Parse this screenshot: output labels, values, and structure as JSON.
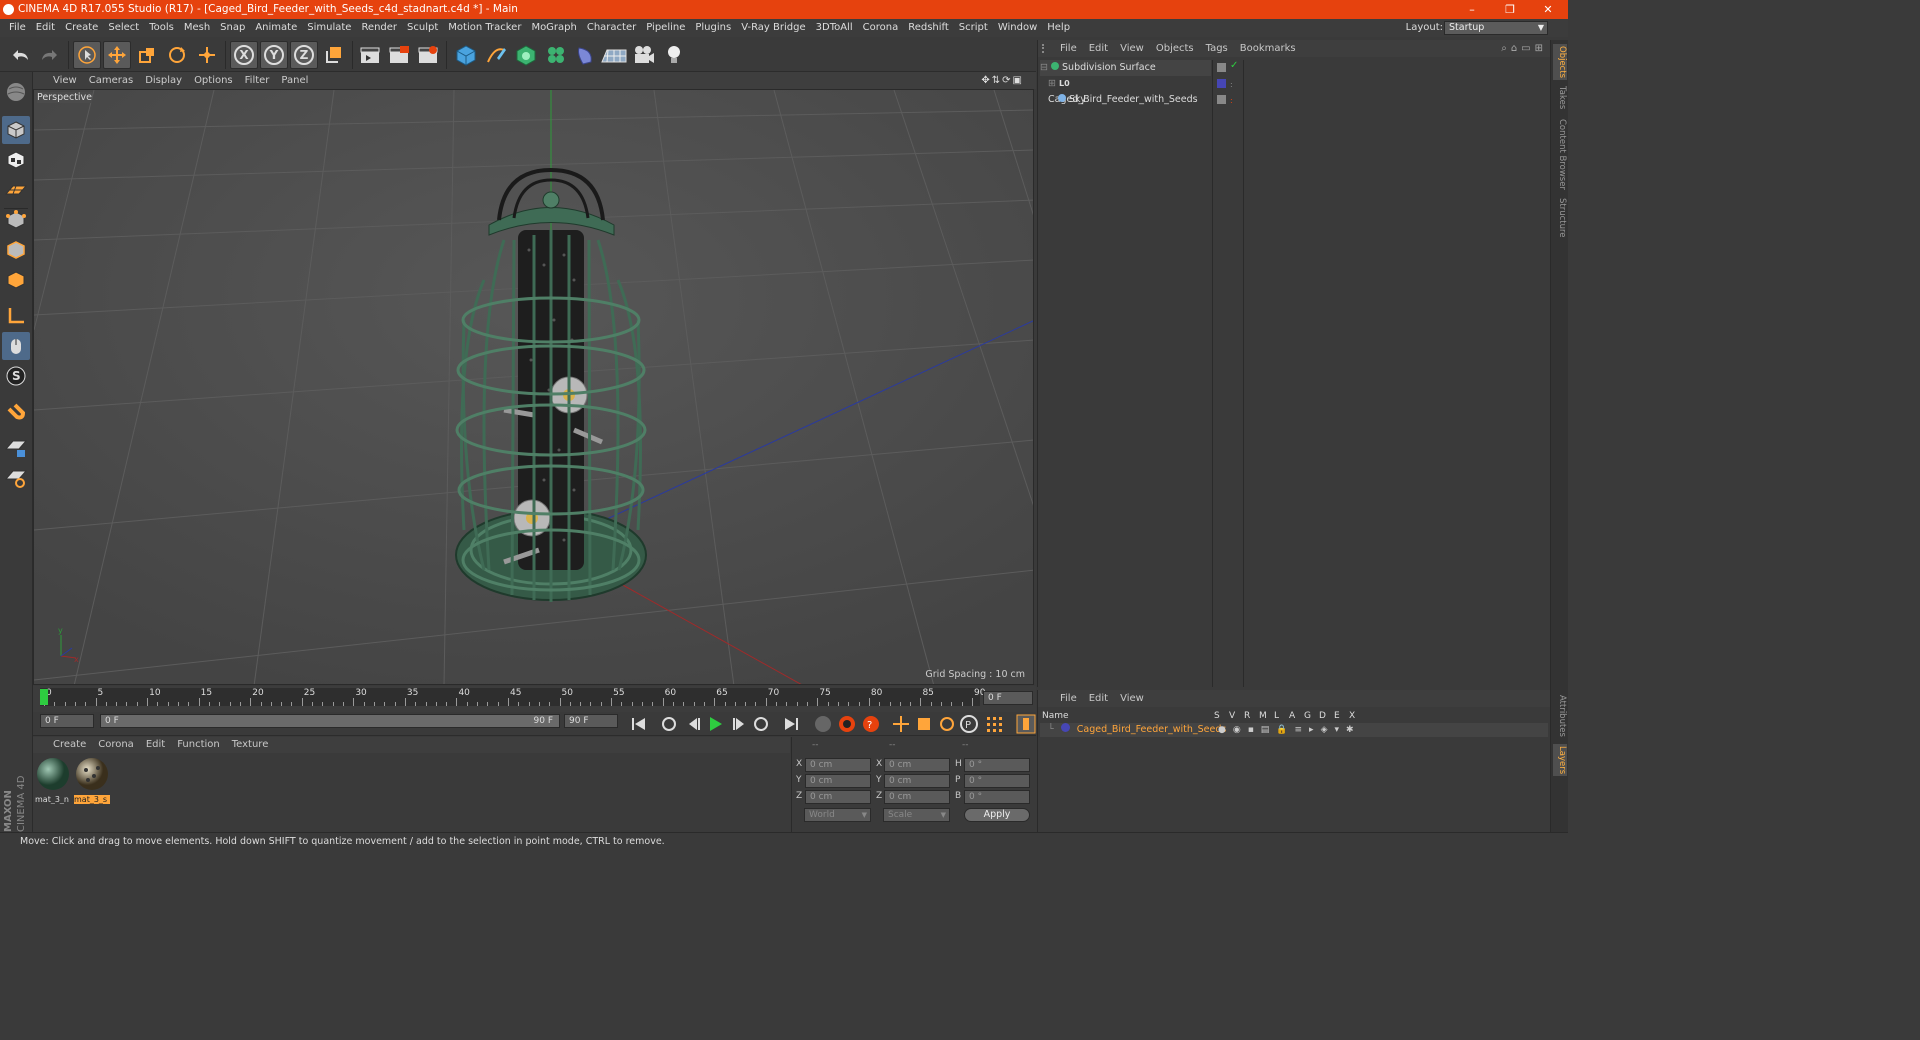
{
  "window": {
    "title": "CINEMA 4D R17.055 Studio (R17) - [Caged_Bird_Feeder_with_Seeds_c4d_stadnart.c4d *] - Main",
    "minimize": "–",
    "restore": "❐",
    "close": "✕"
  },
  "menu": {
    "items": [
      "File",
      "Edit",
      "Create",
      "Select",
      "Tools",
      "Mesh",
      "Snap",
      "Animate",
      "Simulate",
      "Render",
      "Sculpt",
      "Motion Tracker",
      "MoGraph",
      "Character",
      "Pipeline",
      "Plugins",
      "V-Ray Bridge",
      "3DToAll",
      "Corona",
      "Redshift",
      "Script",
      "Window",
      "Help"
    ],
    "layout_label": "Layout:",
    "layout_value": "Startup"
  },
  "toolbar": {
    "axis_x": "X",
    "axis_y": "Y",
    "axis_z": "Z"
  },
  "viewport": {
    "menu": [
      "View",
      "Cameras",
      "Display",
      "Options",
      "Filter",
      "Panel"
    ],
    "label": "Perspective",
    "grid_spacing": "Grid Spacing : 10 cm"
  },
  "timeline": {
    "ticks": [
      "0",
      "5",
      "10",
      "15",
      "20",
      "25",
      "30",
      "35",
      "40",
      "45",
      "50",
      "55",
      "60",
      "65",
      "70",
      "75",
      "80",
      "85",
      "90"
    ],
    "current_frame": "0 F",
    "start_field": "0 F",
    "range_start": "0 F",
    "range_end": "90 F",
    "end_field": "90 F"
  },
  "materials": {
    "menu": [
      "Create",
      "Corona",
      "Edit",
      "Function",
      "Texture"
    ],
    "items": [
      {
        "label": "mat_3_n"
      },
      {
        "label": "mat_3_s"
      }
    ]
  },
  "coordinates": {
    "header": [
      "--",
      "--",
      "--"
    ],
    "rows": [
      {
        "axis1": "X",
        "val1": "0 cm",
        "axis2": "X",
        "val2": "0 cm",
        "axis3": "H",
        "val3": "0 °"
      },
      {
        "axis1": "Y",
        "val1": "0 cm",
        "axis2": "Y",
        "val2": "0 cm",
        "axis3": "P",
        "val3": "0 °"
      },
      {
        "axis1": "Z",
        "val1": "0 cm",
        "axis2": "Z",
        "val2": "0 cm",
        "axis3": "B",
        "val3": "0 °"
      }
    ],
    "mode1": "World",
    "mode2": "Scale",
    "apply": "Apply"
  },
  "objects": {
    "menu": [
      "File",
      "Edit",
      "View",
      "Objects",
      "Tags",
      "Bookmarks"
    ],
    "tree": [
      {
        "name": "Subdivision Surface"
      },
      {
        "name": "Caged_Bird_Feeder_with_Seeds"
      },
      {
        "name": "Sky"
      }
    ]
  },
  "layers": {
    "menu": [
      "File",
      "Edit",
      "View"
    ],
    "col_name": "Name",
    "cols": [
      "S",
      "V",
      "R",
      "M",
      "L",
      "A",
      "G",
      "D",
      "E",
      "X"
    ],
    "row_name": "Caged_Bird_Feeder_with_Seeds"
  },
  "right_tabs": [
    "Objects",
    "Takes",
    "Content Browser",
    "Structure",
    "Attributes",
    "Layers"
  ],
  "brand": {
    "line1": "MAXON",
    "line2": "CINEMA 4D"
  },
  "status": "Move: Click and drag to move elements. Hold down SHIFT to quantize movement / add to the selection in point mode, CTRL to remove.",
  "colors": {
    "titlebar": "#e6420e",
    "accent": "#ffa53a",
    "viewport_bg": "#4b4b4b",
    "cage_green": "#3f6b55"
  }
}
